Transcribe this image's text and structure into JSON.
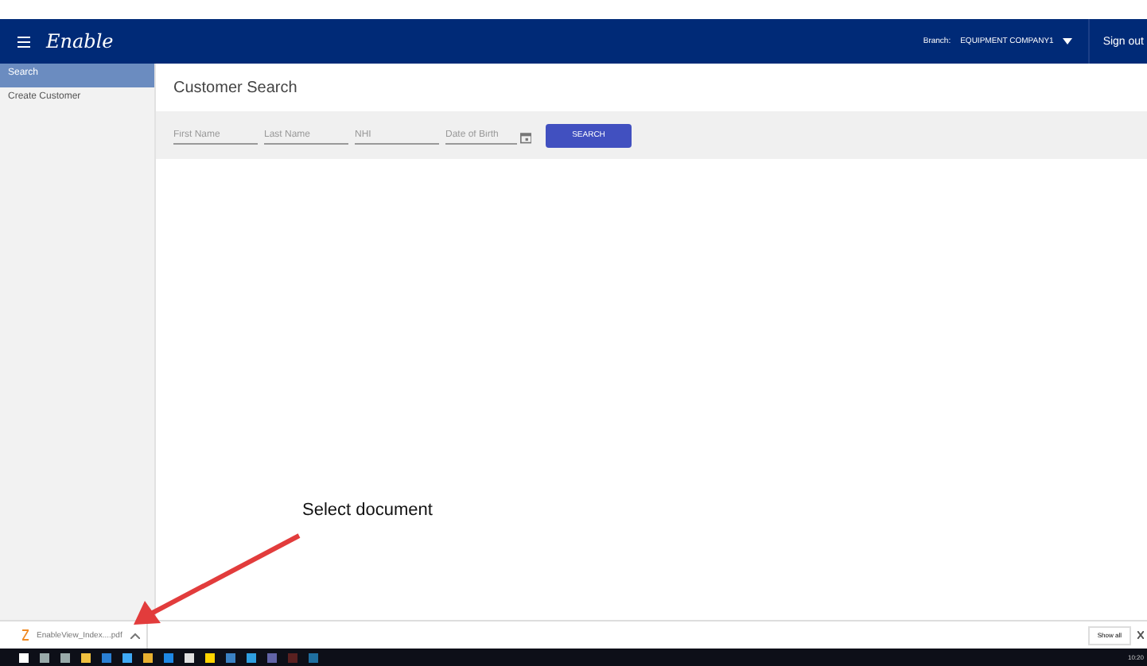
{
  "header": {
    "logo": "Enable",
    "branch_label": "Branch:",
    "branch_value": "EQUIPMENT COMPANY1",
    "sign_out": "Sign out"
  },
  "sidebar": {
    "items": [
      {
        "label": "Search",
        "selected": true
      },
      {
        "label": "Create Customer",
        "selected": false
      }
    ]
  },
  "page": {
    "title": "Customer Search",
    "fields": [
      {
        "placeholder": "First Name",
        "kind": "text"
      },
      {
        "placeholder": "Last Name",
        "kind": "text"
      },
      {
        "placeholder": "NHI",
        "kind": "text"
      },
      {
        "placeholder": "Date of Birth",
        "kind": "date"
      }
    ],
    "search_button": "SEARCH"
  },
  "annotation": {
    "text": "Select document"
  },
  "download_bar": {
    "file": "EnableView_Index....pdf",
    "show_all": "Show all"
  },
  "taskbar": {
    "clock": "10:20"
  }
}
